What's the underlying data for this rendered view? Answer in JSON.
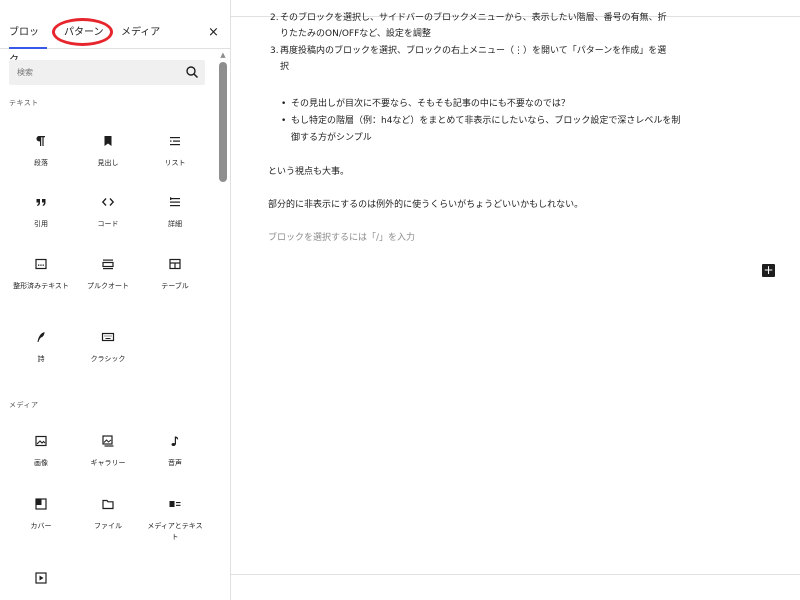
{
  "sidebar": {
    "tabs": {
      "blocks": "ブロック",
      "patterns": "パターン",
      "media": "メディア"
    },
    "close_symbol": "×",
    "search_placeholder": "検索",
    "categories": {
      "text": "テキスト",
      "media": "メディア"
    },
    "text_blocks": [
      {
        "label": "段落",
        "icon": "paragraph-icon"
      },
      {
        "label": "見出し",
        "icon": "heading-icon"
      },
      {
        "label": "リスト",
        "icon": "list-icon"
      },
      {
        "label": "引用",
        "icon": "quote-icon"
      },
      {
        "label": "コード",
        "icon": "code-icon"
      },
      {
        "label": "詳細",
        "icon": "details-icon"
      },
      {
        "label": "整形済みテキスト",
        "icon": "preformatted-icon"
      },
      {
        "label": "プルクオート",
        "icon": "pullquote-icon"
      },
      {
        "label": "テーブル",
        "icon": "table-icon"
      },
      {
        "label": "詩",
        "icon": "verse-icon"
      },
      {
        "label": "クラシック",
        "icon": "classic-icon"
      }
    ],
    "media_blocks": [
      {
        "label": "画像",
        "icon": "image-icon"
      },
      {
        "label": "ギャラリー",
        "icon": "gallery-icon"
      },
      {
        "label": "音声",
        "icon": "audio-icon"
      },
      {
        "label": "カバー",
        "icon": "cover-icon"
      },
      {
        "label": "ファイル",
        "icon": "file-icon"
      },
      {
        "label": "メディアとテキスト",
        "icon": "media-text-icon"
      }
    ]
  },
  "editor": {
    "ol_item2_line1": "そのブロックを選択し、サイドバーのブロックメニューから、表示したい階層、番号の有無、折",
    "ol_item2_line2": "りたたみのON/OFFなど、設定を調整",
    "ol_item3_num": "3.",
    "ol_item2_num": "2.",
    "ol_item3_line1": "再度投稿内のブロックを選択、ブロックの右上メニュー（⋮）を開いて「パターンを作成」を選",
    "ol_item3_line2": "択",
    "ul_items": [
      "その見出しが目次に不要なら、そもそも記事の中にも不要なのでは？",
      "もし特定の階層（例：h4など）をまとめて非表示にしたいなら、ブロック設定で深さレベルを制",
      "御する方がシンプル"
    ],
    "para1": "という視点も大事。",
    "para2": "部分的に非表示にするのは例外的に使うくらいがちょうどいいかもしれない。",
    "placeholder": "ブロックを選択するには「/」を入力",
    "add_symbol": "+"
  }
}
